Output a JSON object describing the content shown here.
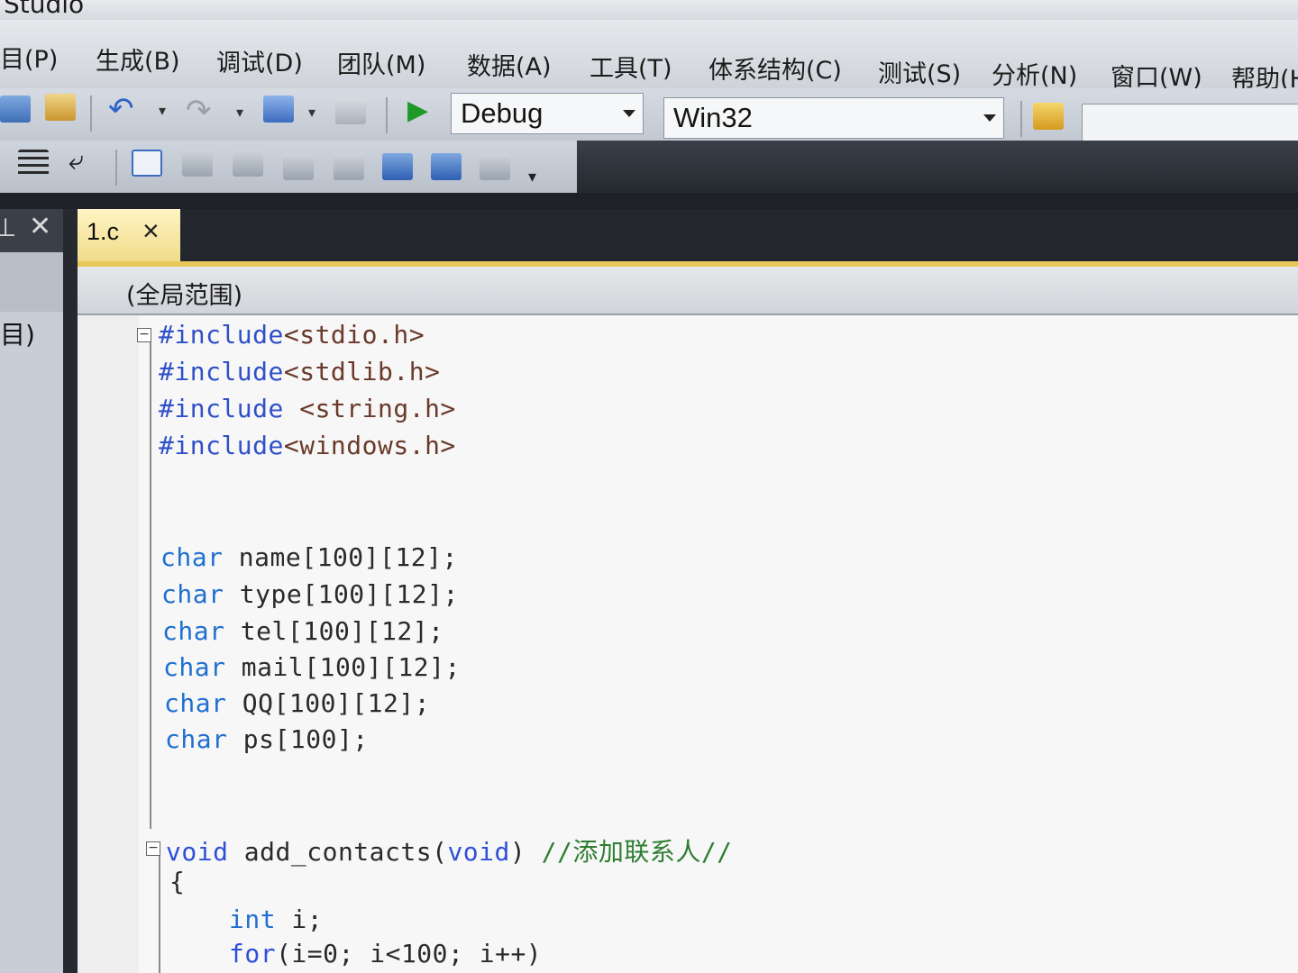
{
  "window": {
    "title": "Studio"
  },
  "menu": [
    {
      "label": "目(P)"
    },
    {
      "label": "生成(B)"
    },
    {
      "label": "调试(D)"
    },
    {
      "label": "团队(M)"
    },
    {
      "label": "数据(A)"
    },
    {
      "label": "工具(T)"
    },
    {
      "label": "体系结构(C)"
    },
    {
      "label": "测试(S)"
    },
    {
      "label": "分析(N)"
    },
    {
      "label": "窗口(W)"
    },
    {
      "label": "帮助(H"
    }
  ],
  "toolbar": {
    "config_value": "Debug",
    "platform_value": "Win32"
  },
  "left_panel": {
    "label": "目)"
  },
  "tab": {
    "label": "1.c",
    "close": "×"
  },
  "scope": {
    "label": "(全局范围)"
  },
  "code": {
    "line1": {
      "directive": "#include",
      "header": "<stdio.h>"
    },
    "line2": {
      "directive": "#include",
      "header": "<stdlib.h>"
    },
    "line3": {
      "directive": "#include",
      "header": " <string.h>"
    },
    "line4": {
      "directive": "#include",
      "header": "<windows.h>"
    },
    "line5": {
      "type": "char",
      "rest": " name[100][12];"
    },
    "line6": {
      "type": "char",
      "rest": " type[100][12];"
    },
    "line7": {
      "type": "char",
      "rest": " tel[100][12];"
    },
    "line8": {
      "type": "char",
      "rest": " mail[100][12];"
    },
    "line9": {
      "type": "char",
      "rest": " QQ[100][12];"
    },
    "line10": {
      "type": "char",
      "rest": " ps[100];"
    },
    "line11": {
      "type": "void",
      "name": " add_contacts(",
      "param": "void",
      "close": ") ",
      "comment": "//添加联系人//"
    },
    "line12": {
      "text": "{"
    },
    "line13": {
      "type": "int",
      "rest": " i;"
    },
    "line14": {
      "kw": "for",
      "rest": "(i=0; i<100; i++)"
    }
  }
}
